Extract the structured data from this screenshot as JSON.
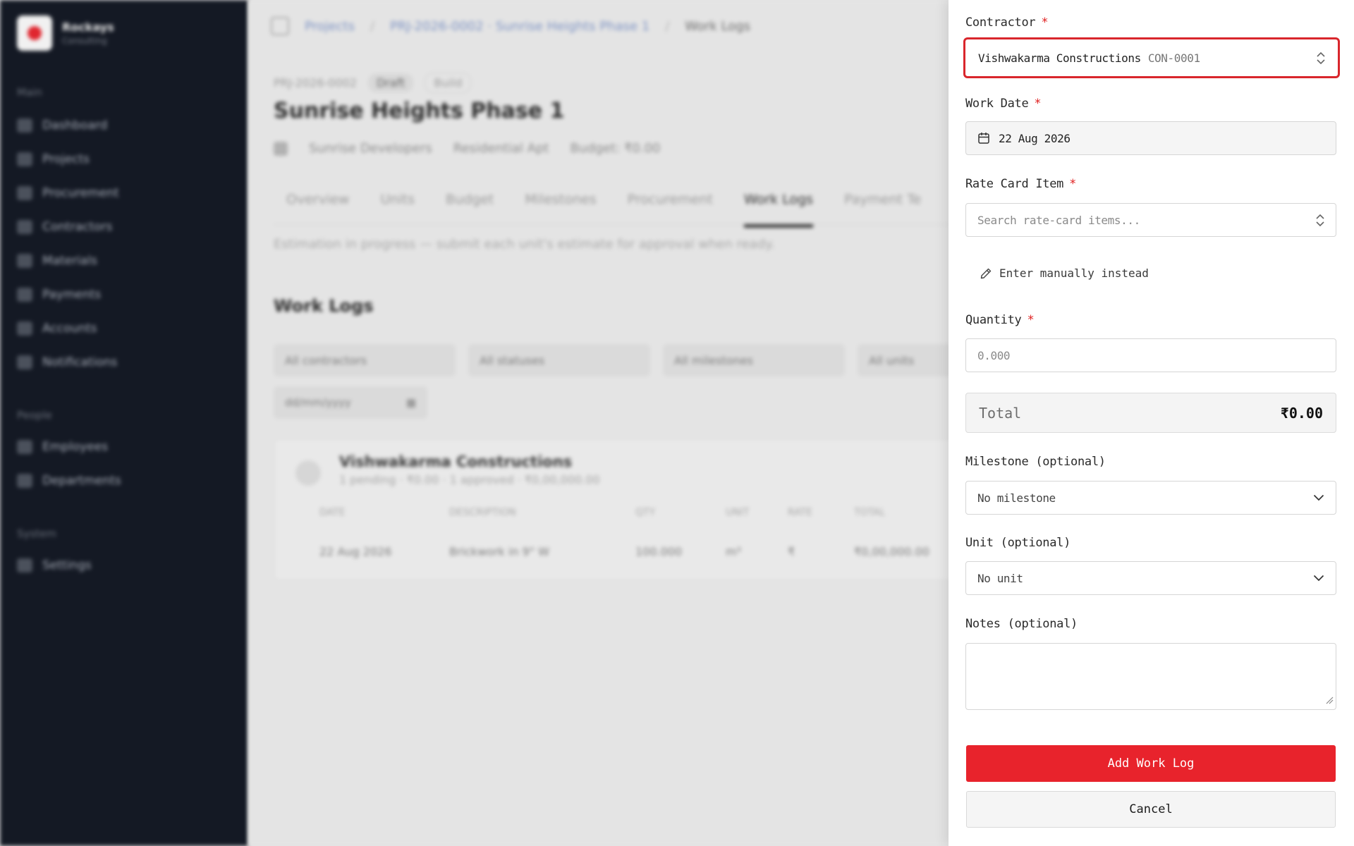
{
  "sidebar": {
    "brand_name": "Rockays",
    "brand_sub": "Consulting",
    "sections": [
      "Main",
      "People",
      "System"
    ],
    "items": [
      {
        "label": "Dashboard"
      },
      {
        "label": "Projects"
      },
      {
        "label": "Procurement"
      },
      {
        "label": "Contractors"
      },
      {
        "label": "Materials"
      },
      {
        "label": "Payments"
      },
      {
        "label": "Accounts"
      },
      {
        "label": "Notifications"
      },
      {
        "label": "Employees"
      },
      {
        "label": "Departments"
      },
      {
        "label": "Settings"
      }
    ]
  },
  "main": {
    "breadcrumb": [
      "Projects",
      "PRJ-2026-0002 · Sunrise Heights Phase 1",
      "Work Logs"
    ],
    "project_code": "PRJ-2026-0002",
    "status_pill": "Draft",
    "status_pill2": "Build",
    "project_title": "Sunrise Heights Phase 1",
    "meta": [
      "Sunrise Developers",
      "Residential Apt",
      "Budget: ₹0.00"
    ],
    "tabs": [
      "Overview",
      "Units",
      "Budget",
      "Milestones",
      "Procurement",
      "Work Logs",
      "Payment Te"
    ],
    "active_tab": "Work Logs",
    "banner": "Estimation in progress — submit each unit's estimate for approval when ready.",
    "section_title": "Work Logs",
    "filters": [
      "All contractors",
      "All statuses",
      "All milestones",
      "All units"
    ],
    "filter_date": "dd/mm/yyyy",
    "group": {
      "name": "Vishwakarma Constructions",
      "summary": "1 pending · ₹0.00 · 1 approved · ₹0,00,000.00",
      "columns": [
        "DATE",
        "DESCRIPTION",
        "QTY",
        "UNIT",
        "RATE",
        "TOTAL"
      ],
      "rows": [
        [
          "22 Aug 2026",
          "Brickwork in 9\" W",
          "100.000",
          "m³",
          "₹",
          "₹0,00,000.00"
        ]
      ]
    }
  },
  "form": {
    "contractor": {
      "label": "Contractor",
      "required_mark": "*",
      "value": "Vishwakarma Constructions",
      "code": "CON-0001"
    },
    "work_date": {
      "label": "Work Date",
      "required_mark": "*",
      "value": "22 Aug 2026"
    },
    "rate_card": {
      "label": "Rate Card Item",
      "required_mark": "*",
      "placeholder": "Search rate-card items..."
    },
    "manual_link": "Enter manually instead",
    "quantity": {
      "label": "Quantity",
      "required_mark": "*",
      "placeholder": "0.000"
    },
    "total": {
      "label": "Total",
      "value": "₹0.00"
    },
    "milestone": {
      "label": "Milestone (optional)",
      "value": "No milestone"
    },
    "unit": {
      "label": "Unit (optional)",
      "value": "No unit"
    },
    "notes": {
      "label": "Notes (optional)"
    },
    "submit_label": "Add Work Log",
    "cancel_label": "Cancel"
  },
  "colors": {
    "accent": "#e8232c",
    "focus_ring": "#d9262c",
    "sidebar_bg": "#141924"
  }
}
